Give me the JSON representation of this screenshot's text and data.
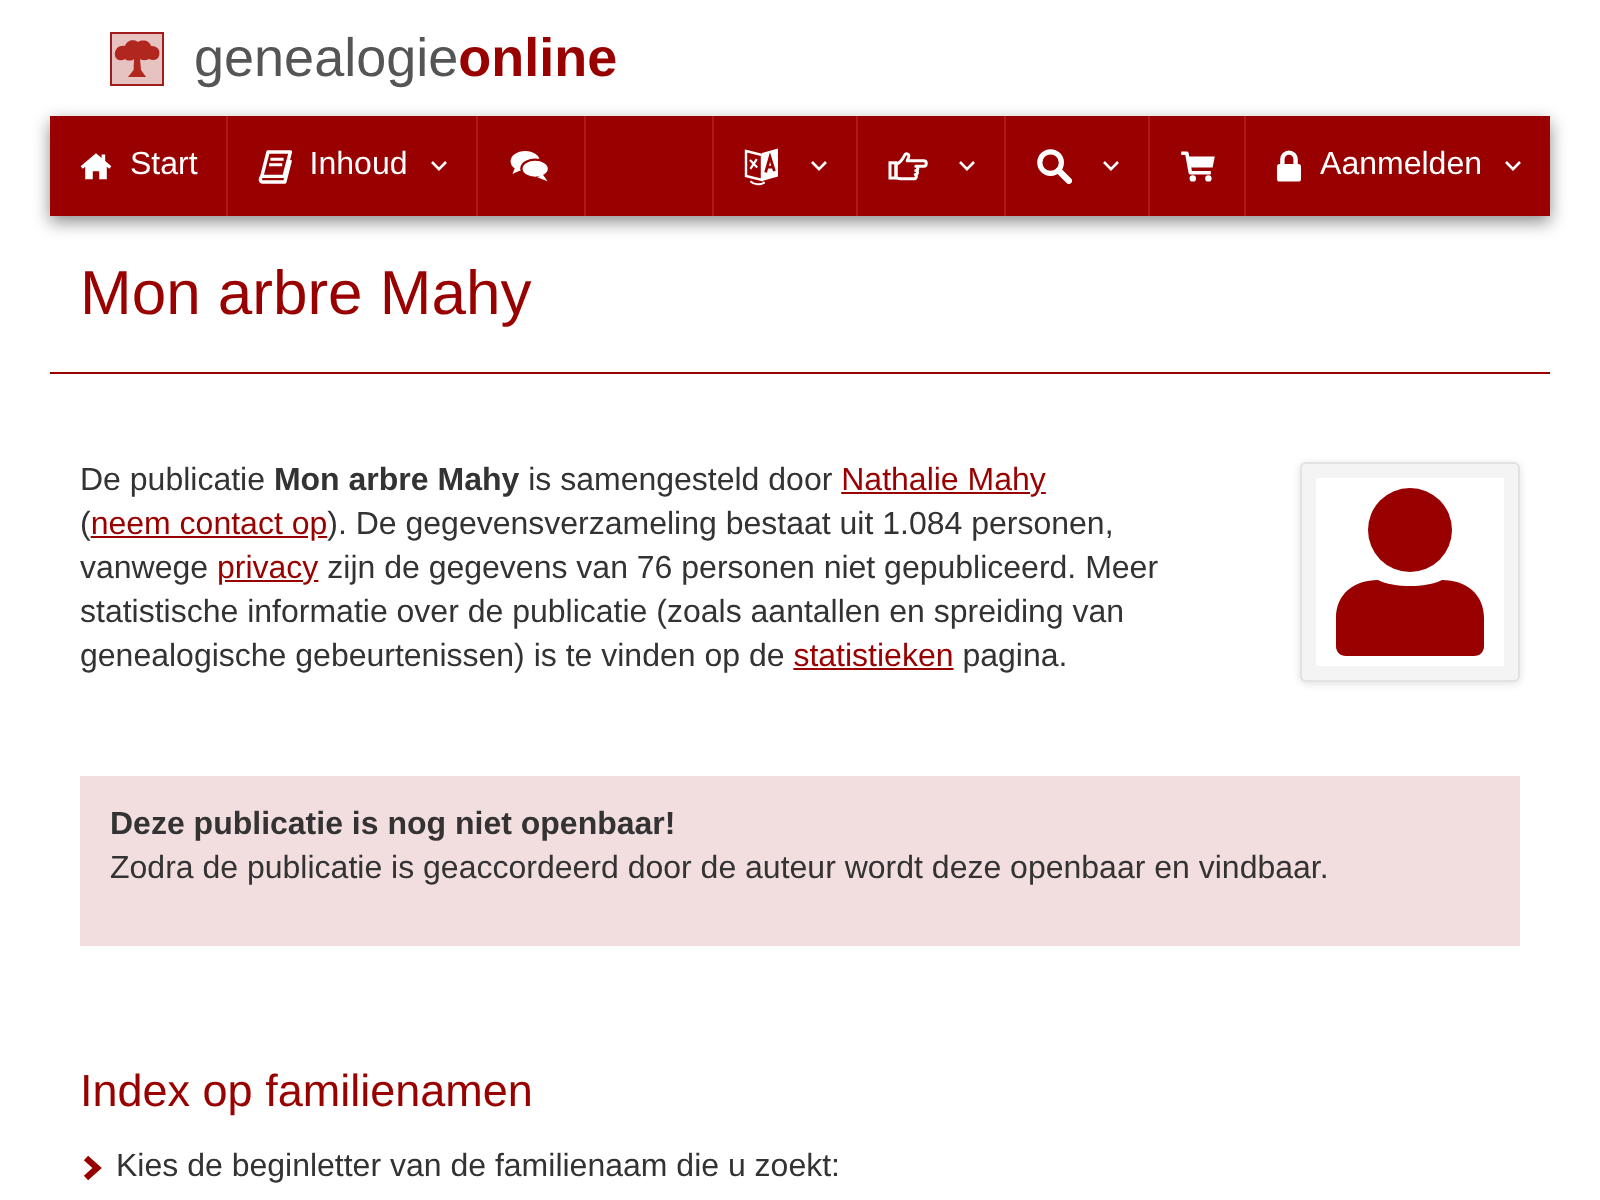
{
  "header": {
    "logo_text": "genealogie**online**"
  },
  "navbar": {
    "left": [
      {
        "label": "Start",
        "dropdown": false
      },
      {
        "label": "Inhoud",
        "dropdown": true
      },
      {
        "dropdown": false
      }
    ],
    "right": [
      {
        "dropdown": true
      },
      {
        "dropdown": true
      },
      {
        "dropdown": true
      },
      {
        "dropdown": false
      },
      {
        "label": "Aanmelden",
        "dropdown": true
      }
    ]
  },
  "page_title": "Mon arbre Mahy",
  "intro": {
    "segments": [
      {
        "kind": "text",
        "text": "De publicatie **Mon arbre Mahy** is samengesteld door "
      },
      {
        "kind": "link",
        "text": "Nathalie Mahy"
      },
      {
        "kind": "text",
        "text": " ("
      },
      {
        "kind": "link",
        "text": "neem contact op"
      },
      {
        "kind": "text",
        "text": "). De gegevensverzameling bestaat uit 1.084 personen, vanwege "
      },
      {
        "kind": "link",
        "text": "privacy"
      },
      {
        "kind": "text",
        "text": " zijn de gegevens van 76 personen niet gepubliceerd. Meer statistische informatie over de publicatie (zoals aantallen en spreiding van genealogische gebeurtenissen) is te vinden op de "
      },
      {
        "kind": "link",
        "text": "statistieken"
      },
      {
        "kind": "text",
        "text": " pagina."
      }
    ]
  },
  "alert": {
    "title": "Deze publicatie is nog niet openbaar!",
    "message": "Zodra de publicatie is geaccordeerd door de auteur wordt deze openbaar en vindbaar."
  },
  "index_section": {
    "heading": "Index op familienamen",
    "instruction": "Kies de beginletter van de familienaam die u zoekt:"
  }
}
